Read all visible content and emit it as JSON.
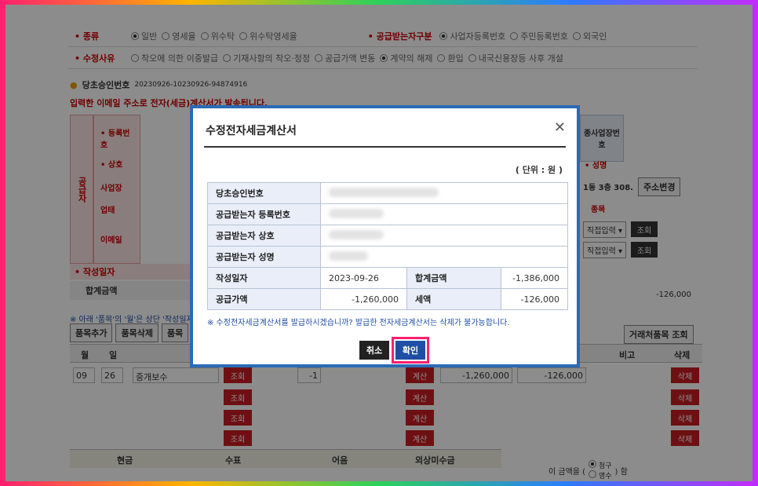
{
  "form": {
    "type_label": "• 종류",
    "type_options": [
      "일반",
      "영세율",
      "위수탁",
      "위수탁영세율"
    ],
    "receiver_label": "• 공급받는자구분",
    "receiver_options": [
      "사업자등록번호",
      "주민등록번호",
      "외국인"
    ],
    "reason_label": "• 수정사유",
    "reason_options": [
      "착오에 의한 이중발급",
      "기재사항의 착오·정정",
      "공급가액 변동",
      "계약의 해제",
      "환입",
      "내국신용장등 사후 개설"
    ],
    "orig_label": "당초승인번호",
    "orig_value": "20230926-10230926-94874916",
    "warning": "입력한 이메일 주소로 전자(세금)계산서가 발송됩니다.",
    "side_label": "공급자",
    "reg_label": "• 등록번호",
    "name_label": "• 상호",
    "addr_label": "사업장",
    "biz_label": "업태",
    "email_label": "이메일",
    "date_label": "• 작성일자",
    "total_label": "합계금액",
    "r_reg_label": "종사업장번호",
    "r_name_label": "• 성명",
    "r_addr_value": "1동 3층 308.",
    "addr_change": "주소변경",
    "r_item_label": "종목",
    "direct_input": "직접입력",
    "lookup": "조회",
    "right_amount": "-126,000",
    "note": "※ 아래 '품목'의 '월'은 상단 '작성일자'",
    "add_item": "품목추가",
    "del_item": "품목삭제",
    "item_trunc": "품목",
    "partner_lookup": "거래처품목 조회",
    "col_month": "월",
    "col_day": "일",
    "col_note": "비고",
    "col_del": "삭제",
    "row1": {
      "month": "09",
      "day": "26",
      "name": "중개보수",
      "qty": "-1",
      "supply": "-1,260,000",
      "tax": "-126,000"
    },
    "calc": "계산",
    "delete": "삭제",
    "pay_cash": "현금",
    "pay_check": "수표",
    "pay_bill": "어음",
    "pay_credit": "외상미수금",
    "claim_text": "이 금액을 (",
    "claim_opt1": "청구",
    "claim_opt2": "영수",
    "claim_end": ") 함"
  },
  "modal": {
    "title": "수정전자세금계산서",
    "unit": "( 단위 : 원 )",
    "rows": {
      "orig_no": "당초승인번호",
      "reg_no": "공급받는자 등록번호",
      "company": "공급받는자 상호",
      "person": "공급받는자 성명",
      "date_label": "작성일자",
      "date_value": "2023-09-26",
      "total_label": "합계금액",
      "total_value": "-1,386,000",
      "supply_label": "공급가액",
      "supply_value": "-1,260,000",
      "tax_label": "세액",
      "tax_value": "-126,000"
    },
    "notice": "※ 수정전자세금계산서를 발급하시겠습니까? 발급한 전자세금계산서는 삭제가 불가능합니다.",
    "cancel": "취소",
    "confirm": "확인"
  },
  "colors": {
    "accent": "#2a6bb5",
    "danger": "#c81e24",
    "highlight": "#ff1f6e"
  }
}
